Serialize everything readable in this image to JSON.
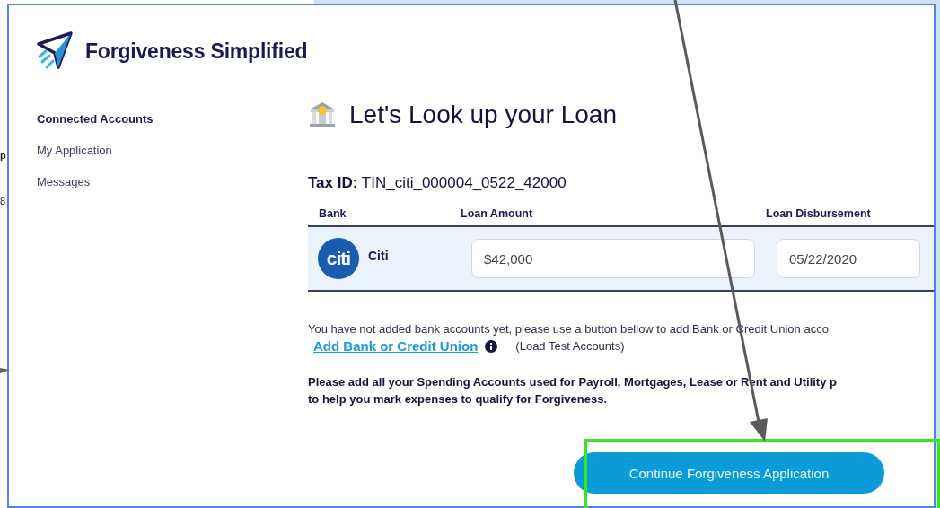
{
  "background_fragments": [
    "p",
    "8"
  ],
  "brand": {
    "name": "Forgiveness Simplified"
  },
  "sidebar": {
    "items": [
      {
        "label": "Connected Accounts",
        "selected": true
      },
      {
        "label": "My Application",
        "selected": false
      },
      {
        "label": "Messages",
        "selected": false
      }
    ]
  },
  "main": {
    "title": "Let's Look up your Loan",
    "tax_id": {
      "label": "Tax ID:",
      "value": "TIN_citi_000004_0522_42000"
    },
    "table": {
      "columns": [
        "Bank",
        "Loan Amount",
        "Loan Disbursement"
      ],
      "rows": [
        {
          "bank": "Citi",
          "bank_logo": "citi",
          "loan_amount": "$42,000",
          "disbursement_date": "05/22/2020"
        }
      ]
    },
    "notice": "You have not added bank accounts yet, please use a button bellow to add Bank or Credit Union acco",
    "add_link": "Add Bank or Credit Union",
    "load_test": "(Load Test Accounts)",
    "hint": "Please add all your Spending Accounts used for Payroll, Mortgages, Lease or Rent and Utility p\nto help you mark expenses to qualify for Forgiveness.",
    "button": "Continue Forgiveness Application"
  }
}
